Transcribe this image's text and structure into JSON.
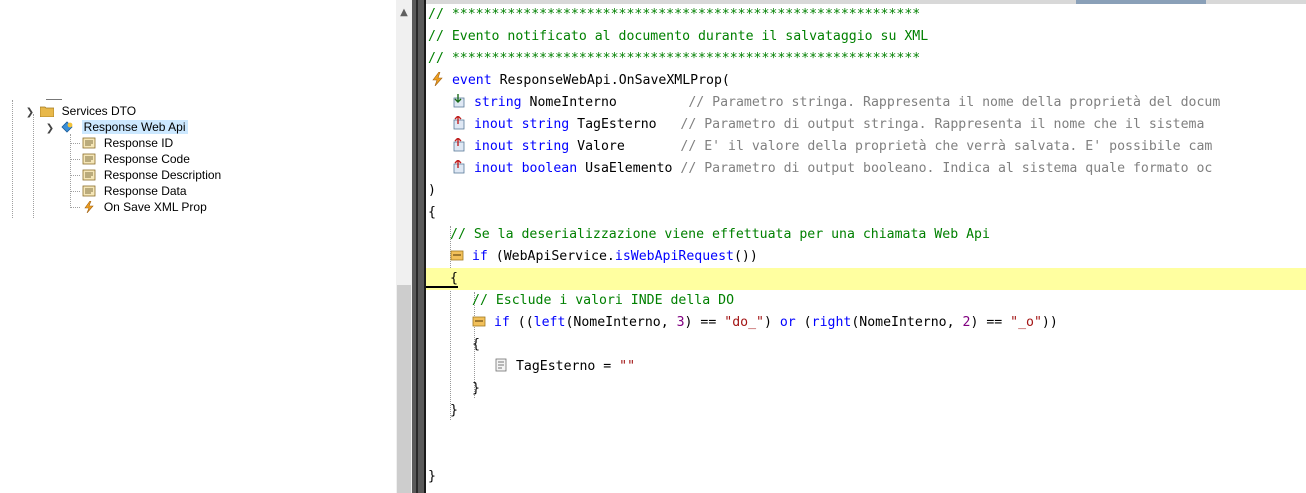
{
  "tree": {
    "items": [
      {
        "label": "Services DTO",
        "icon": "folder-icon"
      },
      {
        "label": "Response Web Api",
        "icon": "web-api-icon"
      },
      {
        "label": "Response ID",
        "icon": "property-icon"
      },
      {
        "label": "Response Code",
        "icon": "property-icon"
      },
      {
        "label": "Response Description",
        "icon": "property-icon"
      },
      {
        "label": "Response Data",
        "icon": "property-icon"
      },
      {
        "label": "On Save XML Prop",
        "icon": "event-icon"
      }
    ]
  },
  "code": {
    "lines": [
      "// ***********************************************************",
      "// Evento notificato al documento durante il salvataggio su XML",
      "// ***********************************************************",
      "event ResponseWebApi.OnSaveXMLProp(",
      "string NomeInterno         // Parametro stringa. Rappresenta il nome della proprietà del docum",
      "inout string TagEsterno   // Parametro di output stringa. Rappresenta il nome che il sistema",
      "inout string Valore       // E' il valore della proprietà che verrà salvata. E' possibile cam",
      "inout boolean UsaElemento // Parametro di output booleano. Indica al sistema quale formato oc",
      ")",
      "{",
      "// Se la deserializzazione viene effettuata per una chiamata Web Api",
      "if (WebApiService.isWebApiRequest())",
      "{",
      "// Esclude i valori INDE della DO",
      "if ((left(NomeInterno, 3) == \"do_\") or (right(NomeInterno, 2) == \"_o\"))",
      "{",
      "TagEsterno = \"\"",
      "}",
      "}",
      "}"
    ]
  },
  "colors": {
    "comment": "#008000",
    "keyword": "#0000ff",
    "string": "#a31515",
    "number": "#800080",
    "highlight": "#ffffa0",
    "selection": "#cce8ff"
  }
}
